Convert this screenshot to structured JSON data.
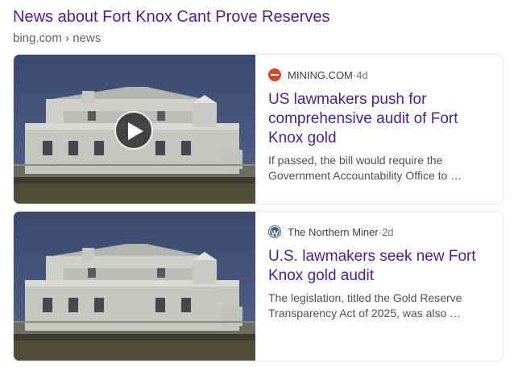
{
  "header": {
    "title": "News about Fort Knox Cant Prove Reserves",
    "breadcrumb": "bing.com › news"
  },
  "articles": [
    {
      "source": "MINING.COM",
      "time": "4d",
      "headline": "US lawmakers push for comprehensive audit of Fort Knox gold",
      "snippet": "If passed, the bill would require the Government Accountability Office to …",
      "source_icon": "mining-com-logo-icon",
      "has_video": true
    },
    {
      "source": "The Northern Miner",
      "time": "2d",
      "headline": "U.S. lawmakers seek new Fort Knox gold audit",
      "snippet": "The legislation, titled the Gold Reserve Transparency Act of 2025, was also …",
      "source_icon": "wordpress-logo-icon",
      "has_video": false
    }
  ],
  "separator": " · ",
  "colors": {
    "title": "#4c1c9c",
    "breadcrumb": "#5f6368",
    "snippet": "#4d5156",
    "mining_icon": "#d7432b",
    "wordpress_icon": "#3d5f8a"
  }
}
